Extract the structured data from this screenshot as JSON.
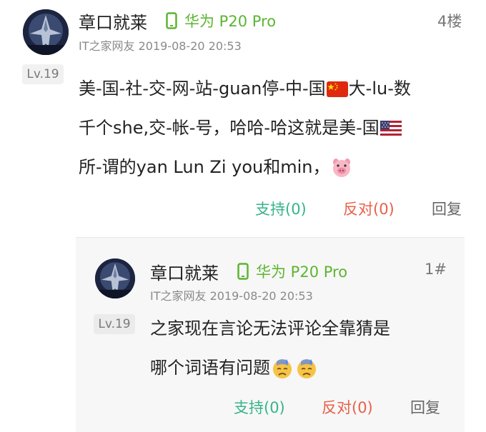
{
  "colors": {
    "device_green": "#5cb531",
    "support_green": "#35b588",
    "oppose_red": "#e8604a",
    "reply_gray": "#666666"
  },
  "comment": {
    "username": "章口就莱",
    "device_icon": "phone-icon",
    "device": "华为 P20 Pro",
    "floor": "4楼",
    "meta": "IT之家网友 2019-08-20 20:53",
    "level": "Lv.19",
    "content_lines": [
      [
        "美-国-社-交-网-站-guan停-中-国",
        "flag-cn",
        "大-lu-数"
      ],
      [
        "千个she,交-帐-号，哈哈-哈这就是美-国",
        "flag-us"
      ],
      [
        "所-谓的yan Lun Zi you和min，",
        "pig-face"
      ]
    ],
    "line1_a": "美-国-社-交-网-站-guan停-中-国",
    "line1_b": "大-lu-数",
    "line2": "千个she,交-帐-号，哈哈-哈这就是美-国",
    "line3": "所-谓的yan Lun Zi you和min，",
    "support": "支持(0)",
    "oppose": "反对(0)",
    "reply": "回复"
  },
  "reply": {
    "username": "章口就莱",
    "device_icon": "phone-icon",
    "device": "华为 P20 Pro",
    "floor": "1#",
    "meta": "IT之家网友 2019-08-20 20:53",
    "level": "Lv.19",
    "line1": "之家现在言论无法评论全靠猜是",
    "line2": "哪个词语有问题",
    "emojis": [
      "sweat-face",
      "sweat-face"
    ],
    "support": "支持(0)",
    "oppose": "反对(0)",
    "reply": "回复"
  }
}
